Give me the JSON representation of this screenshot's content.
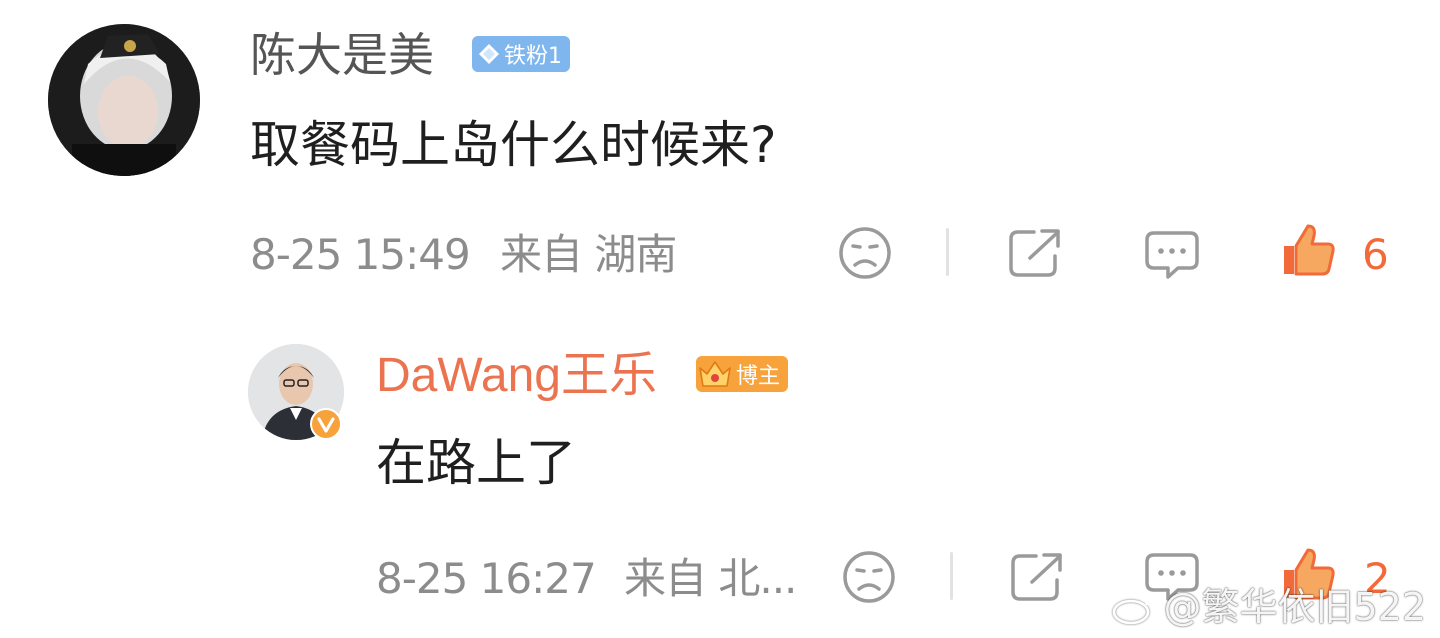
{
  "comment": {
    "author": "陈大是美",
    "badge_label": "铁粉1",
    "text": "取餐码上岛什么时候来?",
    "time": "8-25 15:49",
    "location": "来自 湖南",
    "like_count": "6"
  },
  "reply": {
    "author": "DaWang王乐",
    "badge_label": "博主",
    "text": "在路上了",
    "time": "8-25 16:27",
    "location": "来自 北...",
    "like_count": "2"
  },
  "watermark": "@繁华依旧522",
  "colors": {
    "name_gray": "#555555",
    "name_orange": "#eb7350",
    "like_active": "#f26a3a",
    "fan_badge": "#7fb6ee",
    "blogger_badge": "#f7a23b",
    "icon_gray": "#9a9a9a"
  },
  "icons": [
    "dislike-face-icon",
    "share-icon",
    "comment-icon",
    "like-thumb-icon",
    "verified-v-icon",
    "diamond-icon",
    "crown-icon",
    "weibo-logo-icon"
  ]
}
